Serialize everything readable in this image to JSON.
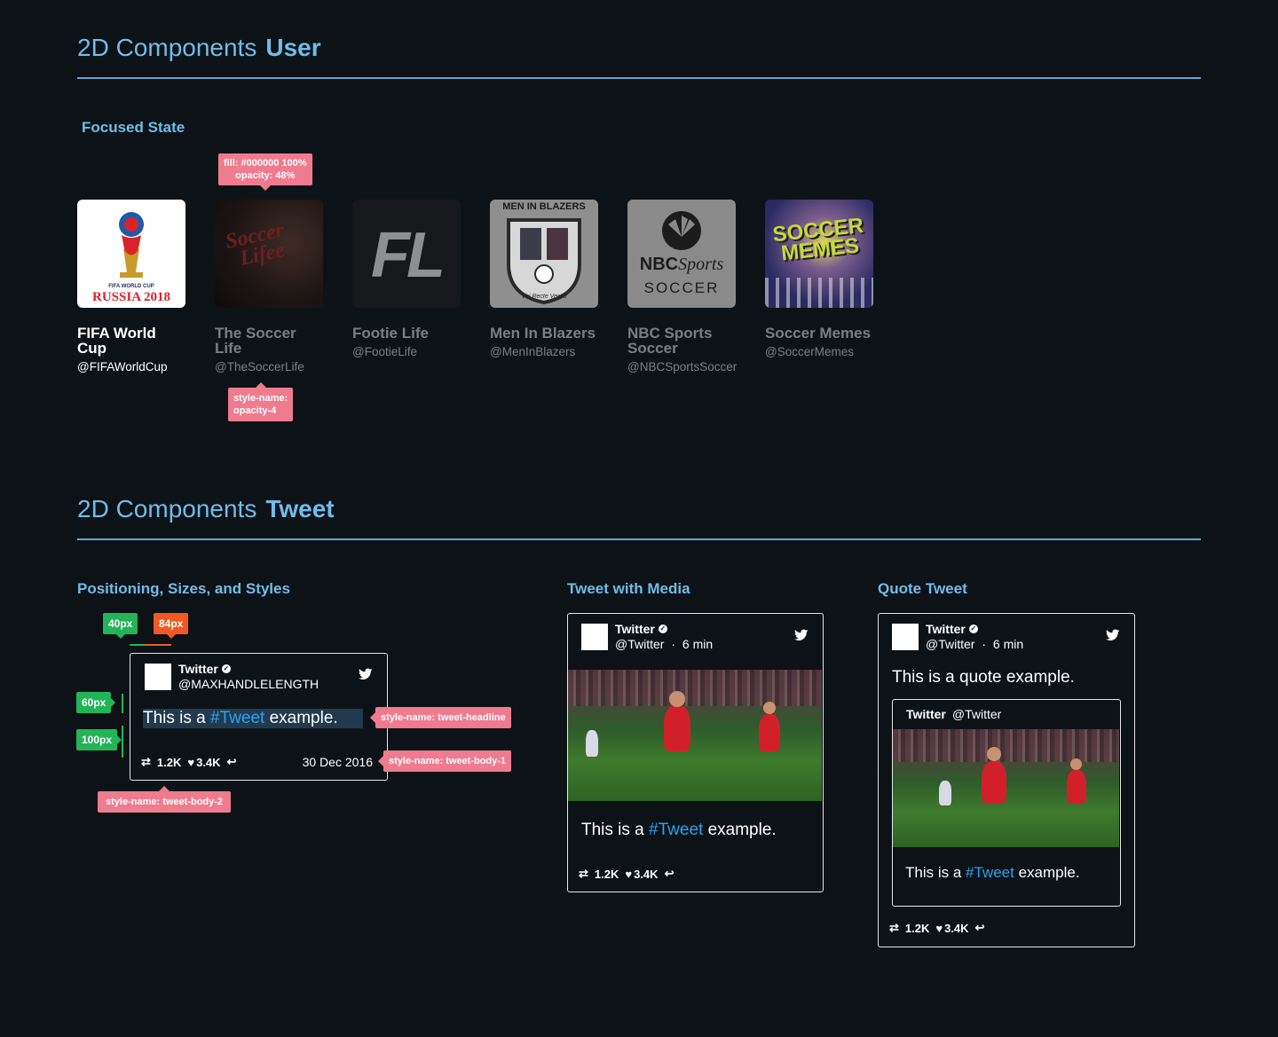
{
  "sections": {
    "user": {
      "prefix": "2D Components",
      "strong": "User",
      "subtitle": "Focused State"
    },
    "tweet": {
      "prefix": "2D Components",
      "strong": "Tweet"
    }
  },
  "annotations": {
    "fill": "fill: #000000 100%",
    "opacity": "opacity: 48%",
    "style_name": "style-name:",
    "opacity_4": "opacity-4",
    "px40": "40px",
    "px84": "84px",
    "px60": "60px",
    "px100": "100px",
    "tweet_headline": "style-name: tweet-headline",
    "tweet_body_1": "style-name: tweet-body-1",
    "tweet_body_2": "style-name: tweet-body-2"
  },
  "accounts": [
    {
      "name_line1": "FIFA World",
      "name_line2": "Cup",
      "handle": "@FIFAWorldCup",
      "logo_lines": [
        "FIFA WORLD CUP",
        "RUSSIA 2018"
      ]
    },
    {
      "name_line1": "The Soccer",
      "name_line2": "Life",
      "handle": "@TheSoccerLife",
      "logo_lines": [
        "Soccer",
        "Lifee"
      ]
    },
    {
      "name_line1": "Footie Life",
      "name_line2": "",
      "handle": "@FootieLife",
      "logo_lines": [
        "FL"
      ]
    },
    {
      "name_line1": "Men In Blazers",
      "name_line2": "",
      "handle": "@MenInBlazers",
      "logo_lines": [
        "MEN IN BLAZERS",
        "Viri Recte Vestiti"
      ]
    },
    {
      "name_line1": "NBC Sports",
      "name_line2": "Soccer",
      "handle": "@NBCSportsSoccer",
      "logo_lines": [
        "NBC",
        "Sports",
        "SOCCER"
      ]
    },
    {
      "name_line1": "Soccer Memes",
      "name_line2": "",
      "handle": "@SoccerMemes",
      "logo_lines": [
        "SOCCER",
        "MEMES"
      ]
    }
  ],
  "tweet_columns": {
    "positioning": "Positioning, Sizes, and Styles",
    "media": "Tweet with Media",
    "quote": "Quote Tweet"
  },
  "tweet_spec": {
    "name": "Twitter",
    "handle": "@MAXHANDLELENGTH",
    "headline_pre": "This is a ",
    "hashtag": "#Tweet",
    "headline_post": " example.",
    "retweets": "1.2K",
    "likes": "3.4K",
    "date": "30 Dec 2016"
  },
  "tweet_media": {
    "name": "Twitter",
    "handle": "@Twitter",
    "time": "6 min",
    "headline_pre": "This is a ",
    "hashtag": "#Tweet",
    "headline_post": " example.",
    "retweets": "1.2K",
    "likes": "3.4K"
  },
  "tweet_quote": {
    "name": "Twitter",
    "handle": "@Twitter",
    "time": "6 min",
    "headline": "This is a quote example.",
    "inner_name": "Twitter",
    "inner_handle": "@Twitter",
    "inner_pre": "This is a ",
    "inner_hashtag": "#Tweet",
    "inner_post": " example.",
    "retweets": "1.2K",
    "likes": "3.4K"
  },
  "glyphs": {
    "dot": "·",
    "verified": "✓",
    "heart": "♥",
    "reply": "↩",
    "retweet": "⇄"
  },
  "colors": {
    "accent": "#6fbdea",
    "hashtag": "#2aa3ef",
    "annotation_pink": "#ef7b8f",
    "annotation_green": "#22b457",
    "annotation_orange": "#f05a22",
    "background": "#0d1217"
  }
}
